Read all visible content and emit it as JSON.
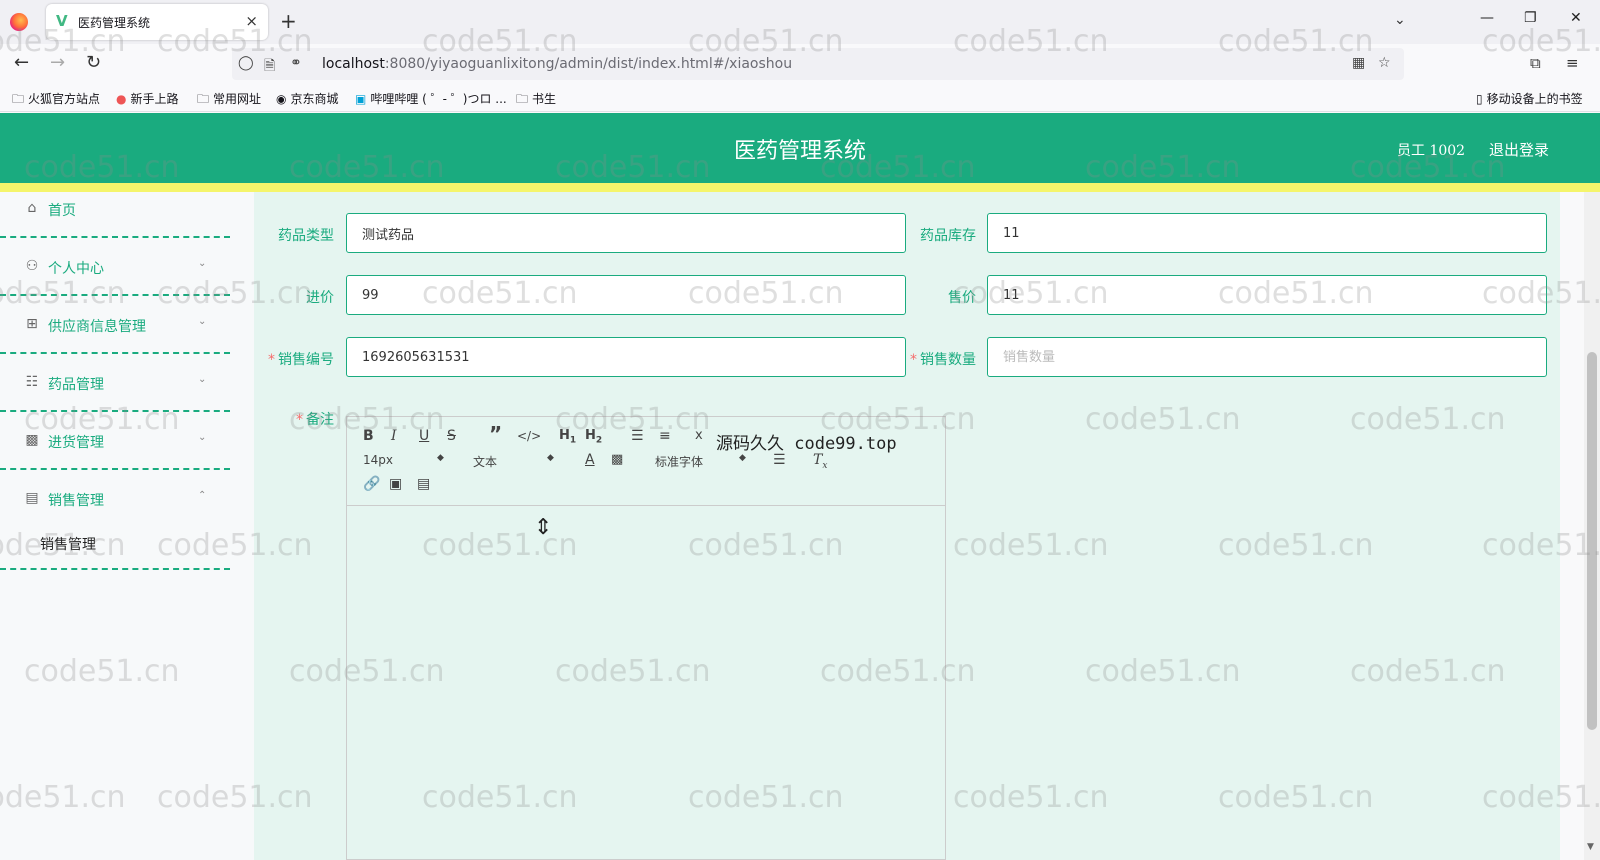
{
  "browser": {
    "tab_title": "医药管理系统",
    "tab_close": "×",
    "new_tab": "+",
    "url_host": "localhost",
    "url_path": ":8080/yiyaoguanlixitong/admin/dist/index.html#/xiaoshou",
    "bookmarks": [
      "火狐官方站点",
      "新手上路",
      "常用网址",
      "京东商城",
      "哔哩哔哩 ( ゜- ゜)つロ ...",
      "书生"
    ],
    "mobile_bookmarks": "移动设备上的书签"
  },
  "header": {
    "title": "医药管理系统",
    "user": "员工 1002",
    "logout": "退出登录"
  },
  "sidebar": {
    "items": [
      {
        "label": "首页",
        "icon": "home-icon"
      },
      {
        "label": "个人中心",
        "icon": "user-icon"
      },
      {
        "label": "供应商信息管理",
        "icon": "crop-icon"
      },
      {
        "label": "药品管理",
        "icon": "globe-icon"
      },
      {
        "label": "进货管理",
        "icon": "chart-icon"
      },
      {
        "label": "销售管理",
        "icon": "ticket-icon"
      }
    ],
    "submenu": "销售管理"
  },
  "form": {
    "drug_type_label": "药品类型",
    "drug_type_value": "测试药品",
    "stock_label": "药品库存",
    "stock_value": "11",
    "purchase_price_label": "进价",
    "purchase_price_value": "99",
    "sale_price_label": "售价",
    "sale_price_value": "11",
    "sale_no_label": "销售编号",
    "sale_no_value": "1692605631531",
    "sale_qty_label": "销售数量",
    "sale_qty_placeholder": "销售数量",
    "remark_label": "备注",
    "required_mark": "*"
  },
  "editor": {
    "font_size": "14px",
    "text_style": "文本",
    "font_family": "标准字体",
    "overlay": "源码久久 code99.top"
  },
  "watermark": "code51.cn",
  "colors": {
    "primary": "#1aab7f",
    "accent_strip": "#f5f56b",
    "content_bg": "#e5f5f0"
  }
}
